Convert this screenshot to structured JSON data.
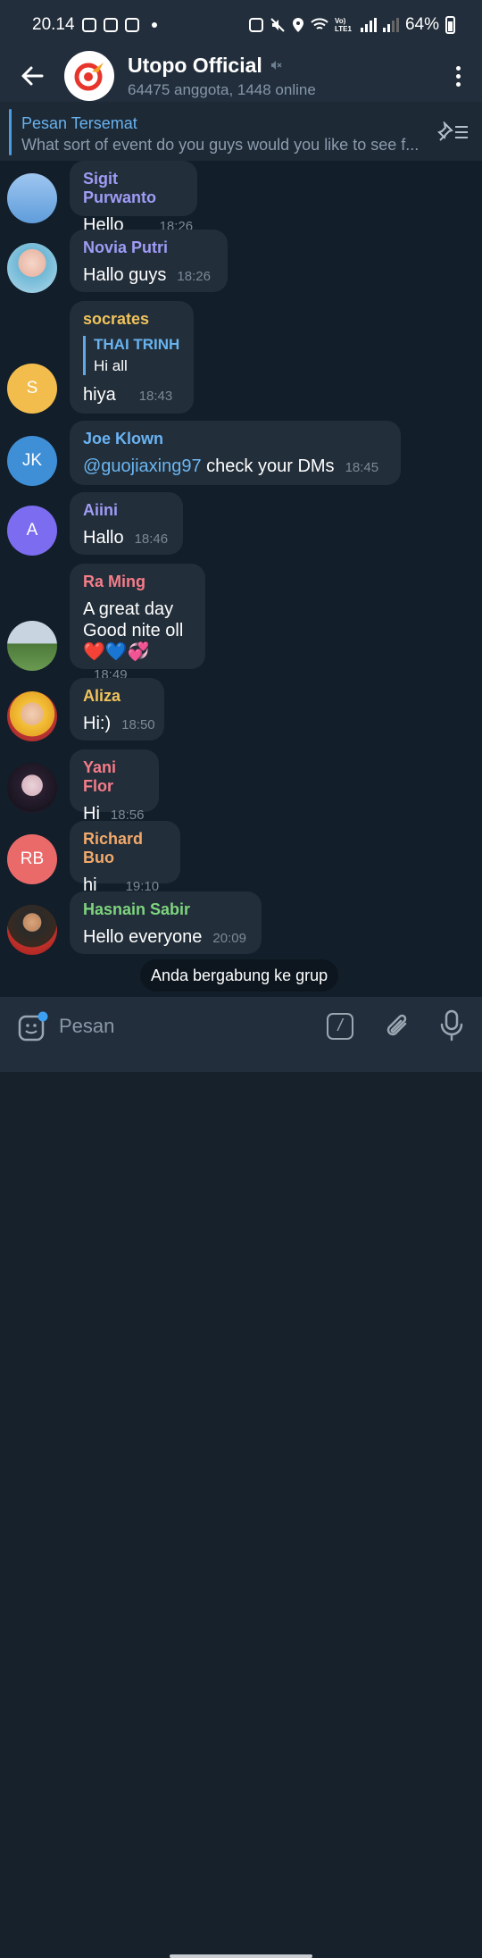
{
  "status": {
    "time": "20.14",
    "battery": "64%",
    "network": "Vo) LTE1"
  },
  "header": {
    "title": "Utopo Official",
    "subtitle": "64475 anggota, 1448 online"
  },
  "pinned": {
    "label": "Pesan Tersemat",
    "text": "What sort of event do you guys would you like to see f..."
  },
  "messages": [
    {
      "sender": "Sigit Purwanto",
      "sender_color": "#9e9cf5",
      "text": "Hello",
      "time": "18:26"
    },
    {
      "sender": "Novia Putri",
      "sender_color": "#9e9cf5",
      "text": "Hallo guys",
      "time": "18:26"
    },
    {
      "sender": "socrates",
      "sender_color": "#f0c35c",
      "avatar_initials": "S",
      "avatar_color": "#f3bd4d",
      "reply": {
        "name": "THAI TRINH",
        "text": "Hi all"
      },
      "text": "hiya",
      "time": "18:43"
    },
    {
      "sender": "Joe Klown",
      "sender_color": "#6ab3f3",
      "avatar_initials": "JK",
      "avatar_color": "#3f8fd7",
      "mention": "@guojiaxing97",
      "text": " check your DMs",
      "time": "18:45"
    },
    {
      "sender": "Aiini",
      "sender_color": "#9e9cf5",
      "avatar_initials": "A",
      "avatar_color": "#7c6cf0",
      "text": "Hallo",
      "time": "18:46"
    },
    {
      "sender": "Ra Ming",
      "sender_color": "#f57c89",
      "line1": "A great day",
      "line2": "Good nite oll",
      "emoji": "❤️💙💞",
      "time": "18:49"
    },
    {
      "sender": "Aliza",
      "sender_color": "#f0c35c",
      "text": "Hi:)",
      "time": "18:50"
    },
    {
      "sender": "Yani Flor",
      "sender_color": "#f57c89",
      "text": "Hi",
      "time": "18:56"
    },
    {
      "sender": "Richard Buo",
      "sender_color": "#f2a96b",
      "avatar_initials": "RB",
      "avatar_color": "#ea6a6a",
      "text": "hi",
      "time": "19:10"
    },
    {
      "sender": "Hasnain Sabir",
      "sender_color": "#7fd57f",
      "text": "Hello everyone",
      "time": "20:09"
    }
  ],
  "service_message": "Anda bergabung ke grup",
  "input": {
    "placeholder": "Pesan"
  }
}
